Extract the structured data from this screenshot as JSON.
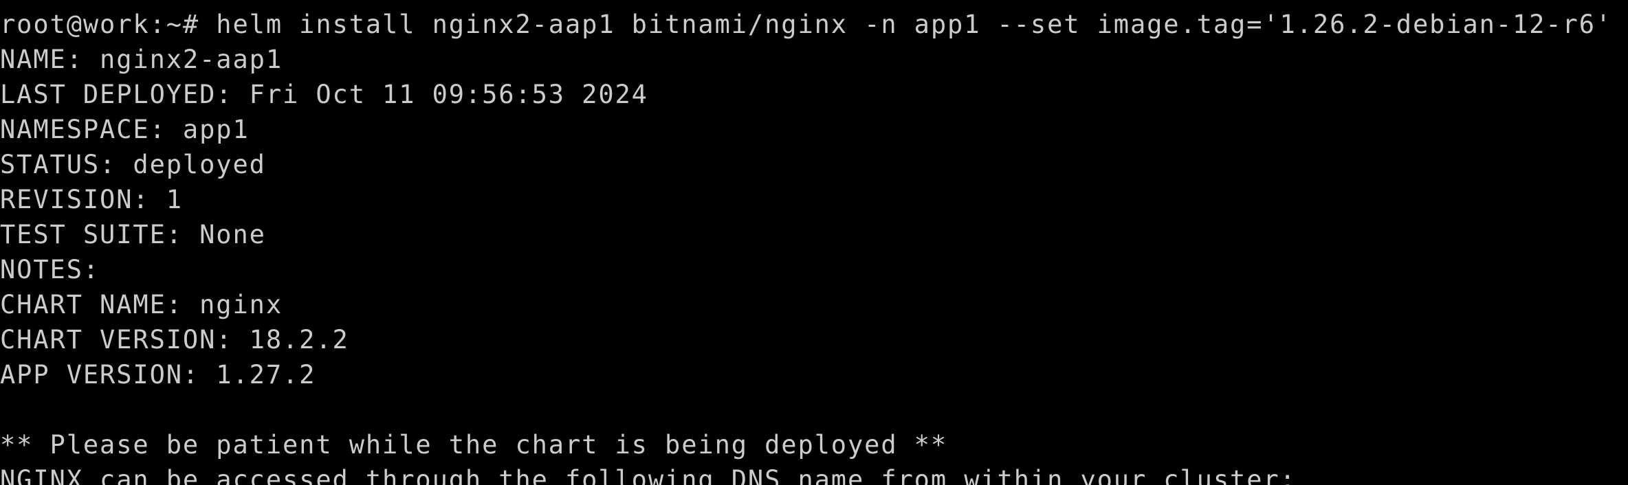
{
  "terminal": {
    "background_color": "#000000",
    "text_color": "#cccccc",
    "lines": [
      "root@work:~# helm install nginx2-aap1 bitnami/nginx -n app1 --set image.tag='1.26.2-debian-12-r6'",
      "NAME: nginx2-aap1",
      "LAST DEPLOYED: Fri Oct 11 09:56:53 2024",
      "NAMESPACE: app1",
      "STATUS: deployed",
      "REVISION: 1",
      "TEST SUITE: None",
      "NOTES:",
      "CHART NAME: nginx",
      "CHART VERSION: 18.2.2",
      "APP VERSION: 1.27.2",
      "",
      "** Please be patient while the chart is being deployed **",
      "NGINX can be accessed through the following DNS name from within your cluster:"
    ]
  }
}
